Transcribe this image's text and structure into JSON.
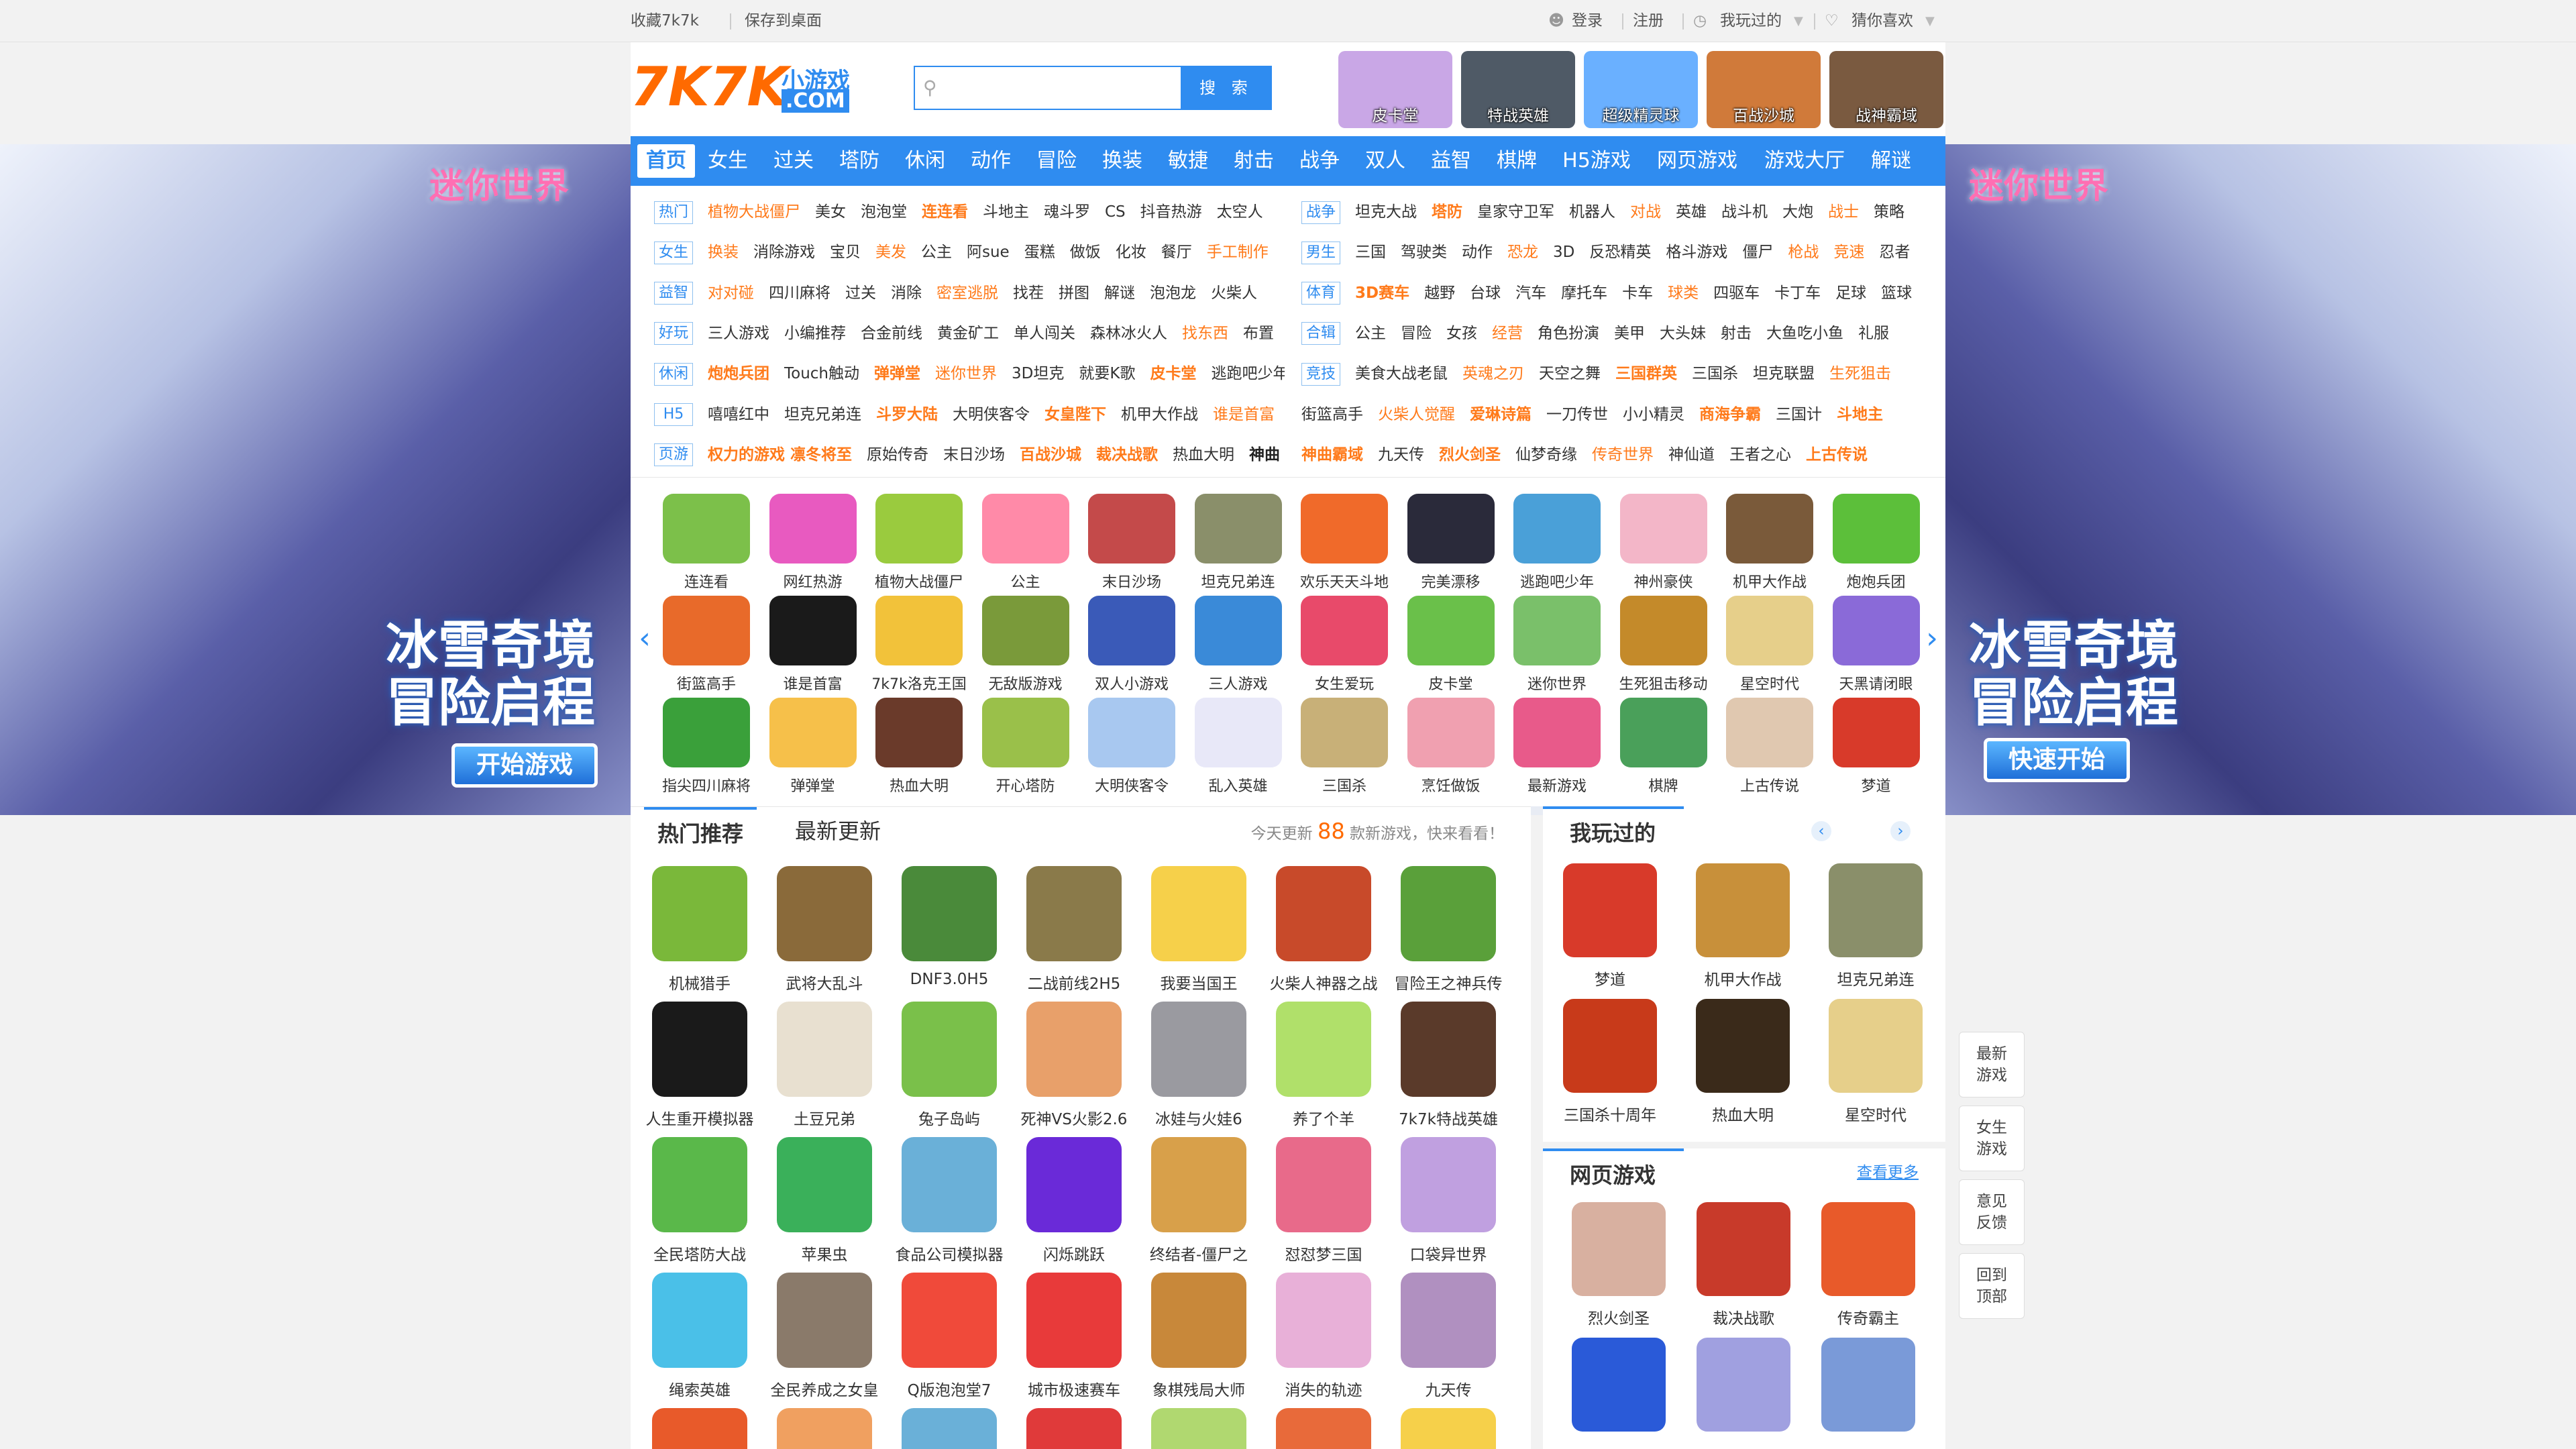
{
  "topbar": {
    "bookmark": "收藏7k7k",
    "save_desktop": "保存到桌面",
    "login": "登录",
    "register": "注册",
    "played": "我玩过的",
    "guess": "猜你喜欢"
  },
  "logo": {
    "text": "7K7K",
    "sub1": "小游戏",
    "sub2": ".COM"
  },
  "search": {
    "placeholder": "",
    "button": "搜 索"
  },
  "header_tiles": [
    {
      "label": "皮卡堂",
      "color": "#c9a7e6"
    },
    {
      "label": "特战英雄",
      "color": "#4f5a66"
    },
    {
      "label": "超级精灵球",
      "color": "#6ab0ff"
    },
    {
      "label": "百战沙城",
      "color": "#d07a3a"
    },
    {
      "label": "战神霸域",
      "color": "#7a5a40"
    }
  ],
  "nav": [
    "首页",
    "女生",
    "过关",
    "塔防",
    "休闲",
    "动作",
    "冒险",
    "换装",
    "敏捷",
    "射击",
    "战争",
    "双人",
    "益智",
    "棋牌",
    "H5游戏",
    "网页游戏",
    "游戏大厅",
    "解谜"
  ],
  "tags_left": [
    {
      "label": "热门",
      "items": [
        {
          "t": "植物大战僵尸",
          "s": "o"
        },
        {
          "t": "美女"
        },
        {
          "t": "泡泡堂"
        },
        {
          "t": "连连看",
          "s": "b"
        },
        {
          "t": "斗地主"
        },
        {
          "t": "魂斗罗"
        },
        {
          "t": "CS"
        },
        {
          "t": "抖音热游"
        },
        {
          "t": "太空人"
        }
      ]
    },
    {
      "label": "女生",
      "items": [
        {
          "t": "换装",
          "s": "o"
        },
        {
          "t": "消除游戏"
        },
        {
          "t": "宝贝"
        },
        {
          "t": "美发",
          "s": "o"
        },
        {
          "t": "公主"
        },
        {
          "t": "阿sue"
        },
        {
          "t": "蛋糕"
        },
        {
          "t": "做饭"
        },
        {
          "t": "化妆"
        },
        {
          "t": "餐厅"
        },
        {
          "t": "手工制作",
          "s": "o"
        }
      ]
    },
    {
      "label": "益智",
      "items": [
        {
          "t": "对对碰",
          "s": "o"
        },
        {
          "t": "四川麻将"
        },
        {
          "t": "过关"
        },
        {
          "t": "消除"
        },
        {
          "t": "密室逃脱",
          "s": "o"
        },
        {
          "t": "找茬"
        },
        {
          "t": "拼图"
        },
        {
          "t": "解谜"
        },
        {
          "t": "泡泡龙"
        },
        {
          "t": "火柴人"
        }
      ]
    },
    {
      "label": "好玩",
      "items": [
        {
          "t": "三人游戏"
        },
        {
          "t": "小编推荐"
        },
        {
          "t": "合金前线"
        },
        {
          "t": "黄金矿工"
        },
        {
          "t": "单人闯关"
        },
        {
          "t": "森林冰火人"
        },
        {
          "t": "找东西",
          "s": "o"
        },
        {
          "t": "布置"
        }
      ]
    },
    {
      "label": "休闲",
      "items": [
        {
          "t": "炮炮兵团",
          "s": "b"
        },
        {
          "t": "Touch触动"
        },
        {
          "t": "弹弹堂",
          "s": "b"
        },
        {
          "t": "迷你世界",
          "s": "o"
        },
        {
          "t": "3D坦克"
        },
        {
          "t": "就要K歌"
        },
        {
          "t": "皮卡堂",
          "s": "b"
        },
        {
          "t": "逃跑吧少年"
        }
      ]
    },
    {
      "label": "H5",
      "items": [
        {
          "t": "嘻嘻红中"
        },
        {
          "t": "坦克兄弟连"
        },
        {
          "t": "斗罗大陆",
          "s": "b"
        },
        {
          "t": "大明侠客令"
        },
        {
          "t": "女皇陛下",
          "s": "b"
        },
        {
          "t": "机甲大作战"
        },
        {
          "t": "谁是首富",
          "s": "o"
        }
      ]
    },
    {
      "label": "页游",
      "items": [
        {
          "t": "权力的游戏 凛冬将至",
          "s": "b"
        },
        {
          "t": "原始传奇"
        },
        {
          "t": "末日沙场"
        },
        {
          "t": "百战沙城",
          "s": "b"
        },
        {
          "t": "裁决战歌",
          "s": "b"
        },
        {
          "t": "热血大明"
        },
        {
          "t": "神曲",
          "s": "k"
        }
      ]
    }
  ],
  "tags_right": [
    {
      "label": "战争",
      "items": [
        {
          "t": "坦克大战"
        },
        {
          "t": "塔防",
          "s": "b"
        },
        {
          "t": "皇家守卫军"
        },
        {
          "t": "机器人"
        },
        {
          "t": "对战",
          "s": "o"
        },
        {
          "t": "英雄"
        },
        {
          "t": "战斗机"
        },
        {
          "t": "大炮"
        },
        {
          "t": "战士",
          "s": "o"
        },
        {
          "t": "策略"
        }
      ]
    },
    {
      "label": "男生",
      "items": [
        {
          "t": "三国"
        },
        {
          "t": "驾驶类"
        },
        {
          "t": "动作"
        },
        {
          "t": "恐龙",
          "s": "o"
        },
        {
          "t": "3D"
        },
        {
          "t": "反恐精英"
        },
        {
          "t": "格斗游戏"
        },
        {
          "t": "僵尸"
        },
        {
          "t": "枪战",
          "s": "o"
        },
        {
          "t": "竞速",
          "s": "o"
        },
        {
          "t": "忍者"
        }
      ]
    },
    {
      "label": "体育",
      "items": [
        {
          "t": "3D赛车",
          "s": "b"
        },
        {
          "t": "越野"
        },
        {
          "t": "台球"
        },
        {
          "t": "汽车"
        },
        {
          "t": "摩托车"
        },
        {
          "t": "卡车"
        },
        {
          "t": "球类",
          "s": "o"
        },
        {
          "t": "四驱车"
        },
        {
          "t": "卡丁车"
        },
        {
          "t": "足球"
        },
        {
          "t": "篮球"
        }
      ]
    },
    {
      "label": "合辑",
      "items": [
        {
          "t": "公主"
        },
        {
          "t": "冒险"
        },
        {
          "t": "女孩"
        },
        {
          "t": "经营",
          "s": "o"
        },
        {
          "t": "角色扮演"
        },
        {
          "t": "美甲"
        },
        {
          "t": "大头妹"
        },
        {
          "t": "射击"
        },
        {
          "t": "大鱼吃小鱼"
        },
        {
          "t": "礼服"
        }
      ]
    },
    {
      "label": "竞技",
      "items": [
        {
          "t": "美食大战老鼠"
        },
        {
          "t": "英魂之刃",
          "s": "o"
        },
        {
          "t": "天空之舞"
        },
        {
          "t": "三国群英",
          "s": "b"
        },
        {
          "t": "三国杀"
        },
        {
          "t": "坦克联盟"
        },
        {
          "t": "生死狙击",
          "s": "o"
        }
      ]
    },
    {
      "label": "",
      "items": [
        {
          "t": "街篮高手"
        },
        {
          "t": "火柴人觉醒",
          "s": "o"
        },
        {
          "t": "爱琳诗篇",
          "s": "b"
        },
        {
          "t": "一刀传世"
        },
        {
          "t": "小小精灵"
        },
        {
          "t": "商海争霸",
          "s": "b"
        },
        {
          "t": "三国计"
        },
        {
          "t": "斗地主",
          "s": "b"
        }
      ]
    },
    {
      "label": "",
      "items": [
        {
          "t": "神曲霸域",
          "s": "b"
        },
        {
          "t": "九天传"
        },
        {
          "t": "烈火剑圣",
          "s": "b"
        },
        {
          "t": "仙梦奇缘"
        },
        {
          "t": "传奇世界",
          "s": "o"
        },
        {
          "t": "神仙道"
        },
        {
          "t": "王者之心"
        },
        {
          "t": "上古传说",
          "s": "b"
        }
      ]
    }
  ],
  "grid_rows": [
    [
      {
        "l": "连连看",
        "c": "#7cc04a"
      },
      {
        "l": "网红热游",
        "c": "#e85ac0"
      },
      {
        "l": "植物大战僵尸",
        "c": "#9acb3e"
      },
      {
        "l": "公主",
        "c": "#ff8aa8"
      },
      {
        "l": "末日沙场",
        "c": "#c44a4a"
      },
      {
        "l": "坦克兄弟连",
        "c": "#8a8f6a"
      },
      {
        "l": "欢乐天天斗地",
        "c": "#f06a2a"
      },
      {
        "l": "完美漂移",
        "c": "#2a2a3a"
      },
      {
        "l": "逃跑吧少年",
        "c": "#4aa0d8"
      },
      {
        "l": "神州豪侠",
        "c": "#f3b6c8"
      },
      {
        "l": "机甲大作战",
        "c": "#7a5a3a"
      },
      {
        "l": "炮炮兵团",
        "c": "#5cbf3a"
      }
    ],
    [
      {
        "l": "街篮高手",
        "c": "#e86a2a"
      },
      {
        "l": "谁是首富",
        "c": "#1a1a1a"
      },
      {
        "l": "7k7k洛克王国",
        "c": "#f2c23a"
      },
      {
        "l": "无敌版游戏",
        "c": "#7a9a3a"
      },
      {
        "l": "双人小游戏",
        "c": "#3a5ab8"
      },
      {
        "l": "三人游戏",
        "c": "#3a8ad8"
      },
      {
        "l": "女生爱玩",
        "c": "#e84a6a"
      },
      {
        "l": "皮卡堂",
        "c": "#6ac04a"
      },
      {
        "l": "迷你世界",
        "c": "#7ac06a"
      },
      {
        "l": "生死狙击移动",
        "c": "#c48a2a"
      },
      {
        "l": "星空时代",
        "c": "#e6cf8a"
      },
      {
        "l": "天黑请闭眼",
        "c": "#8a6ad8"
      }
    ],
    [
      {
        "l": "指尖四川麻将",
        "c": "#3aa03a"
      },
      {
        "l": "弹弹堂",
        "c": "#f6c04a"
      },
      {
        "l": "热血大明",
        "c": "#6a3a2a"
      },
      {
        "l": "开心塔防",
        "c": "#9ac04a"
      },
      {
        "l": "大明侠客令",
        "c": "#a8c8f0"
      },
      {
        "l": "乱入英雄",
        "c": "#e8e8f8"
      },
      {
        "l": "三国杀",
        "c": "#c8b078"
      },
      {
        "l": "烹饪做饭",
        "c": "#f0a0b0"
      },
      {
        "l": "最新游戏",
        "c": "#e85a8a"
      },
      {
        "l": "棋牌",
        "c": "#4aa05a"
      },
      {
        "l": "上古传说",
        "c": "#e0c8b0"
      },
      {
        "l": "梦道",
        "c": "#d83a2a"
      }
    ]
  ],
  "hot": {
    "tab1": "热门推荐",
    "tab2": "最新更新",
    "notice_pre": "今天更新",
    "notice_count": "88",
    "notice_post": "款新游戏，快来看看！",
    "rows": [
      [
        {
          "l": "机械猎手",
          "c": "#7ab83a"
        },
        {
          "l": "武将大乱斗",
          "c": "#8a6a3a"
        },
        {
          "l": "DNF3.0H5",
          "c": "#4a8a3a"
        },
        {
          "l": "二战前线2H5",
          "c": "#8a7a4a"
        },
        {
          "l": "我要当国王",
          "c": "#f6d04a"
        },
        {
          "l": "火柴人神器之战",
          "c": "#c84a2a"
        },
        {
          "l": "冒险王之神兵传",
          "c": "#5aa03a"
        }
      ],
      [
        {
          "l": "人生重开模拟器",
          "c": "#1a1a1a"
        },
        {
          "l": "土豆兄弟",
          "c": "#e8e0d0"
        },
        {
          "l": "兔子岛屿",
          "c": "#7ac04a"
        },
        {
          "l": "死神VS火影2.6",
          "c": "#e8a06a"
        },
        {
          "l": "冰娃与火娃6",
          "c": "#9a9aa0"
        },
        {
          "l": "养了个羊",
          "c": "#b0e06a"
        },
        {
          "l": "7k7k特战英雄",
          "c": "#5a3a2a"
        }
      ],
      [
        {
          "l": "全民塔防大战",
          "c": "#5ab84a"
        },
        {
          "l": "苹果虫",
          "c": "#3ab05a"
        },
        {
          "l": "食品公司模拟器",
          "c": "#6ab0d8"
        },
        {
          "l": "闪烁跳跃",
          "c": "#6a2ad8"
        },
        {
          "l": "终结者-僵尸之",
          "c": "#d8a04a"
        },
        {
          "l": "怼怼梦三国",
          "c": "#e86a8a"
        },
        {
          "l": "口袋异世界",
          "c": "#c0a0e0"
        }
      ],
      [
        {
          "l": "绳索英雄",
          "c": "#4ac0e8"
        },
        {
          "l": "全民养成之女皇",
          "c": "#8a7a6a"
        },
        {
          "l": "Q版泡泡堂7",
          "c": "#f04a3a"
        },
        {
          "l": "城市极速赛车",
          "c": "#e83a3a"
        },
        {
          "l": "象棋残局大师",
          "c": "#c8883a"
        },
        {
          "l": "消失的轨迹",
          "c": "#e8b0d8"
        },
        {
          "l": "九天传",
          "c": "#b090c0"
        }
      ]
    ]
  },
  "played": {
    "title": "我玩过的",
    "items": [
      {
        "l": "梦道",
        "c": "#d83a2a"
      },
      {
        "l": "机甲大作战",
        "c": "#c8903a"
      },
      {
        "l": "坦克兄弟连",
        "c": "#8a8f6a"
      },
      {
        "l": "三国杀十周年",
        "c": "#c83a1a"
      },
      {
        "l": "热血大明",
        "c": "#3a2a1a"
      },
      {
        "l": "星空时代",
        "c": "#e6cf8a"
      }
    ]
  },
  "webgames": {
    "title": "网页游戏",
    "more": "查看更多",
    "items": [
      {
        "l": "烈火剑圣",
        "c": "#d8b0a0"
      },
      {
        "l": "裁决战歌",
        "c": "#c83a2a"
      },
      {
        "l": "传奇霸主",
        "c": "#e85a2a"
      },
      {
        "l": "",
        "c": "#2a5ad8"
      },
      {
        "l": "",
        "c": "#a0a0e0"
      },
      {
        "l": "",
        "c": "#7a9ad8"
      }
    ]
  },
  "promo_left": {
    "title": "迷你世界",
    "line1": "冰雪奇境",
    "line2": "冒险启程",
    "button": "开始游戏"
  },
  "promo_right": {
    "title": "迷你世界",
    "line1": "冰雪奇境",
    "line2": "冒险启程",
    "button": "快速开始"
  },
  "side": [
    [
      "最新",
      "游戏"
    ],
    [
      "女生",
      "游戏"
    ],
    [
      "意见",
      "反馈"
    ],
    [
      "回到",
      "顶部"
    ]
  ]
}
